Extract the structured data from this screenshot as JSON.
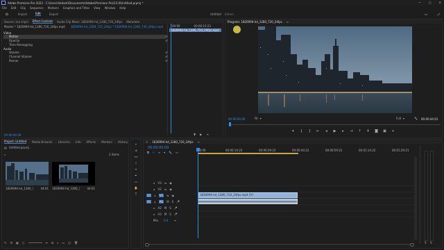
{
  "window": {
    "title": "Adobe Premiere Pro 2023 - C:\\Users\\Vedant\\Documents\\Adobe\\Premiere Pro\\23.0\\Untitled.prproj *"
  },
  "menu": [
    "File",
    "Edit",
    "Clip",
    "Sequence",
    "Markers",
    "Graphics and Titles",
    "View",
    "Window",
    "Help"
  ],
  "workspace": {
    "home": "Home",
    "tabs": [
      "Import",
      "Edit",
      "Export"
    ],
    "active": "Edit",
    "project_name": "Untitled",
    "edited": "Edited"
  },
  "source_panel": {
    "tabs": [
      "Source: (no clips)",
      "Effect Controls",
      "Audio Clip Mixer: 1826994-hd_1280_720_24fps",
      "Metadata"
    ],
    "active": "Effect Controls",
    "master": "Master * 1826994-hd_1280_720_24fps.mp4",
    "sequence": "1826994-hd_1280_720_24fps * 1826994-hd_1280_720_24fps.mp4",
    "timecode": "00:00:00:00",
    "ruler_times": [
      "00:00",
      "00:00:15:23"
    ],
    "clip_label": "1826994-hd_1280_720_24fps.mp4",
    "sections": [
      {
        "label": "Video",
        "items": [
          "Motion",
          "Opacity",
          "Time Remapping"
        ]
      },
      {
        "label": "Audio",
        "items": [
          "Volume",
          "Channel Volume",
          "Panner"
        ]
      }
    ]
  },
  "program_monitor": {
    "title": "Program: 1826994-hd_1280_720_24fps",
    "timecode": "00:00:00:00",
    "fit": "Fit",
    "quality": "Full",
    "duration": "00:00:44:01"
  },
  "project_panel": {
    "tabs": [
      "Project: Untitled",
      "Media Browser",
      "Libraries",
      "Info",
      "Effects",
      "Markers",
      "History"
    ],
    "active": "Project: Untitled",
    "file": "Untitled.prproj",
    "item_count": "2 items",
    "items": [
      {
        "name": "1826994-hd_1280_720_24fps",
        "duration": "44:01"
      },
      {
        "name": "1826994-hd_1280_720_24fps",
        "duration": "44:01"
      }
    ]
  },
  "timeline": {
    "tab": "1826994-hd_1280_720_24fps",
    "timecode": "00:00:00:00",
    "ruler": [
      "00:00",
      "00:00:14:23",
      "00:00:29:23",
      "00:00:44:22",
      "00:00:59:22",
      "00:01:14:22",
      "00:01:29:21"
    ],
    "video_tracks": [
      "V3",
      "V2",
      "V1"
    ],
    "audio_tracks": [
      "A1",
      "A2",
      "A3"
    ],
    "mix_label": "Mix",
    "mix_value": "0.0",
    "video_clip": "1826994-hd_1280_720_24fps.mp4 [V]",
    "play_from": "00:00:00:00"
  },
  "colors": {
    "accent": "#2d8ceb",
    "video_clip": "#8eb4df",
    "audio_clip": "#a6b8cc",
    "playhead": "#2d8ceb",
    "bg": "#1d1d1d"
  }
}
